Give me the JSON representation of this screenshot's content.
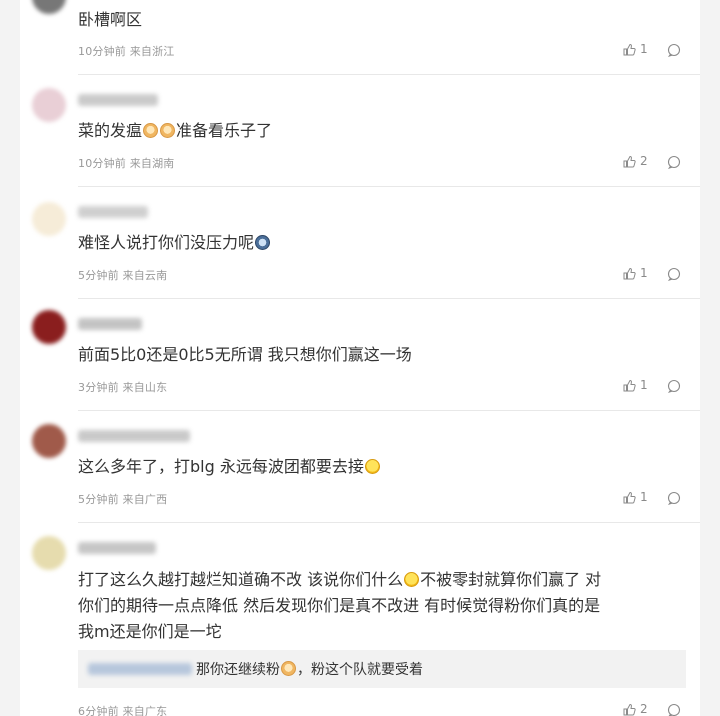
{
  "comments": [
    {
      "text": "卧槽啊区",
      "meta": "10分钟前 来自浙江",
      "likes": "1"
    },
    {
      "text_a": "菜的发瘟",
      "text_b": "准备看乐子了",
      "meta": "10分钟前 来自湖南",
      "likes": "2"
    },
    {
      "text": "难怪人说打你们没压力呢",
      "meta": "5分钟前 来自云南",
      "likes": "1"
    },
    {
      "text": "前面5比0还是0比5无所谓 我只想你们赢这一场",
      "meta": "3分钟前 来自山东",
      "likes": "1"
    },
    {
      "text": "这么多年了，打blg 永远每波团都要去接",
      "meta": "5分钟前 来自广西",
      "likes": "1"
    },
    {
      "line1_a": "打了这么久越打越烂知道确不改 该说你们什么",
      "line1_b": "不被零封就算你们赢了 对",
      "line2": "你们的期待一点点降低 然后发现你们是真不改进 有时候觉得粉你们真的是",
      "line3": "我m还是你们是一坨",
      "reply_a": "那你还继续粉",
      "reply_b": "，粉这个队就要受着",
      "meta": "6分钟前 来自广东",
      "likes": "2"
    }
  ],
  "icons": {
    "like": "thumbs-up-icon",
    "comment": "comment-bubble-icon",
    "emoji_dog": "dog-face-emoji-icon",
    "emoji_smile": "smile-emoji-icon",
    "emoji_cry": "crying-face-emoji-icon"
  },
  "colors": {
    "text": "#333333",
    "meta": "#999999",
    "divider": "#e8e8e8",
    "reply_bg": "#f2f2f2"
  }
}
